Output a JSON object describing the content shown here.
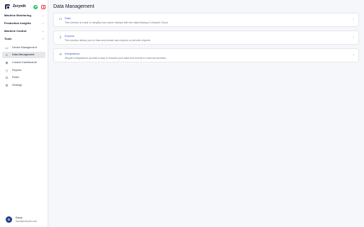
{
  "brand": {
    "name": "Zerynth"
  },
  "sidebar": {
    "groups": [
      {
        "label": "Machine Monitoring"
      },
      {
        "label": "Production Insights"
      },
      {
        "label": "Machine Control"
      },
      {
        "label": "Tools"
      }
    ],
    "items": [
      {
        "label": "Device Management",
        "icon": "device-icon"
      },
      {
        "label": "Data Management",
        "icon": "database-icon",
        "active": true
      },
      {
        "label": "Custom Dashboards",
        "icon": "dashboard-icon"
      },
      {
        "label": "Reports",
        "icon": "document-icon"
      },
      {
        "label": "Rules",
        "icon": "rules-icon"
      },
      {
        "label": "Settings",
        "icon": "gear-icon"
      }
    ]
  },
  "user": {
    "initial": "D",
    "name": "Doca",
    "email": "doca@zerynth.com"
  },
  "main": {
    "title": "Data Management",
    "cards": [
      {
        "title": "Data",
        "description": "This section is made to simplify how users interact with the data flowing to Zerynth Cloud.",
        "icon": "data-icon"
      },
      {
        "title": "Exports",
        "description": "This section allows you to view and create raw exports or periodic exports.",
        "icon": "download-icon"
      },
      {
        "title": "Integrations",
        "description": "Zerynth Integrations provide a way to forward your data and events to external services.",
        "icon": "share-icon"
      }
    ]
  },
  "colors": {
    "accent": "#3b5bdb",
    "brand": "#1e2a5e",
    "status": "#22c55e"
  }
}
